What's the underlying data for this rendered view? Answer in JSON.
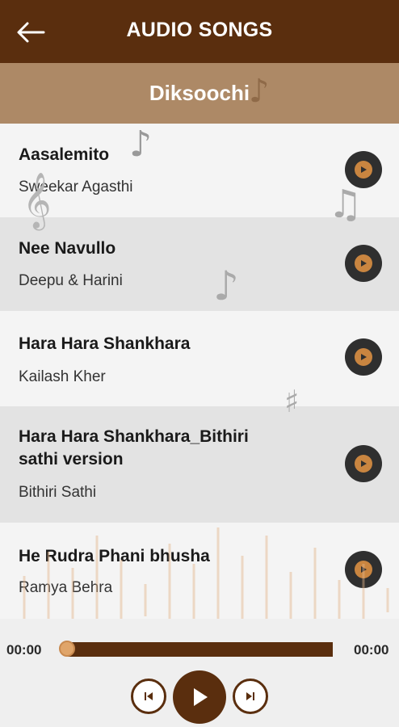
{
  "header": {
    "title": "AUDIO SONGS",
    "back_icon": "arrow-left-icon"
  },
  "album": {
    "title": "Diksoochi"
  },
  "songs": [
    {
      "title": "Aasalemito",
      "artist": "Sweekar Agasthi"
    },
    {
      "title": "Nee Navullo",
      "artist": "Deepu & Harini"
    },
    {
      "title": "Hara Hara Shankhara",
      "artist": "Kailash Kher"
    },
    {
      "title": "Hara Hara Shankhara_Bithiri sathi version",
      "artist": "Bithiri Sathi"
    },
    {
      "title": "He Rudra Phani bhusha",
      "artist": "Ramya Behra"
    }
  ],
  "player": {
    "current_time": "00:00",
    "total_time": "00:00",
    "progress": 0,
    "prev_icon": "skip-previous-icon",
    "play_icon": "play-icon",
    "next_icon": "skip-next-icon"
  },
  "colors": {
    "primary": "#5a2e0e",
    "album_bar": "#ad8966",
    "row_light": "#f4f4f4",
    "row_dark": "#e3e3e3",
    "play_accent": "#c98540"
  }
}
